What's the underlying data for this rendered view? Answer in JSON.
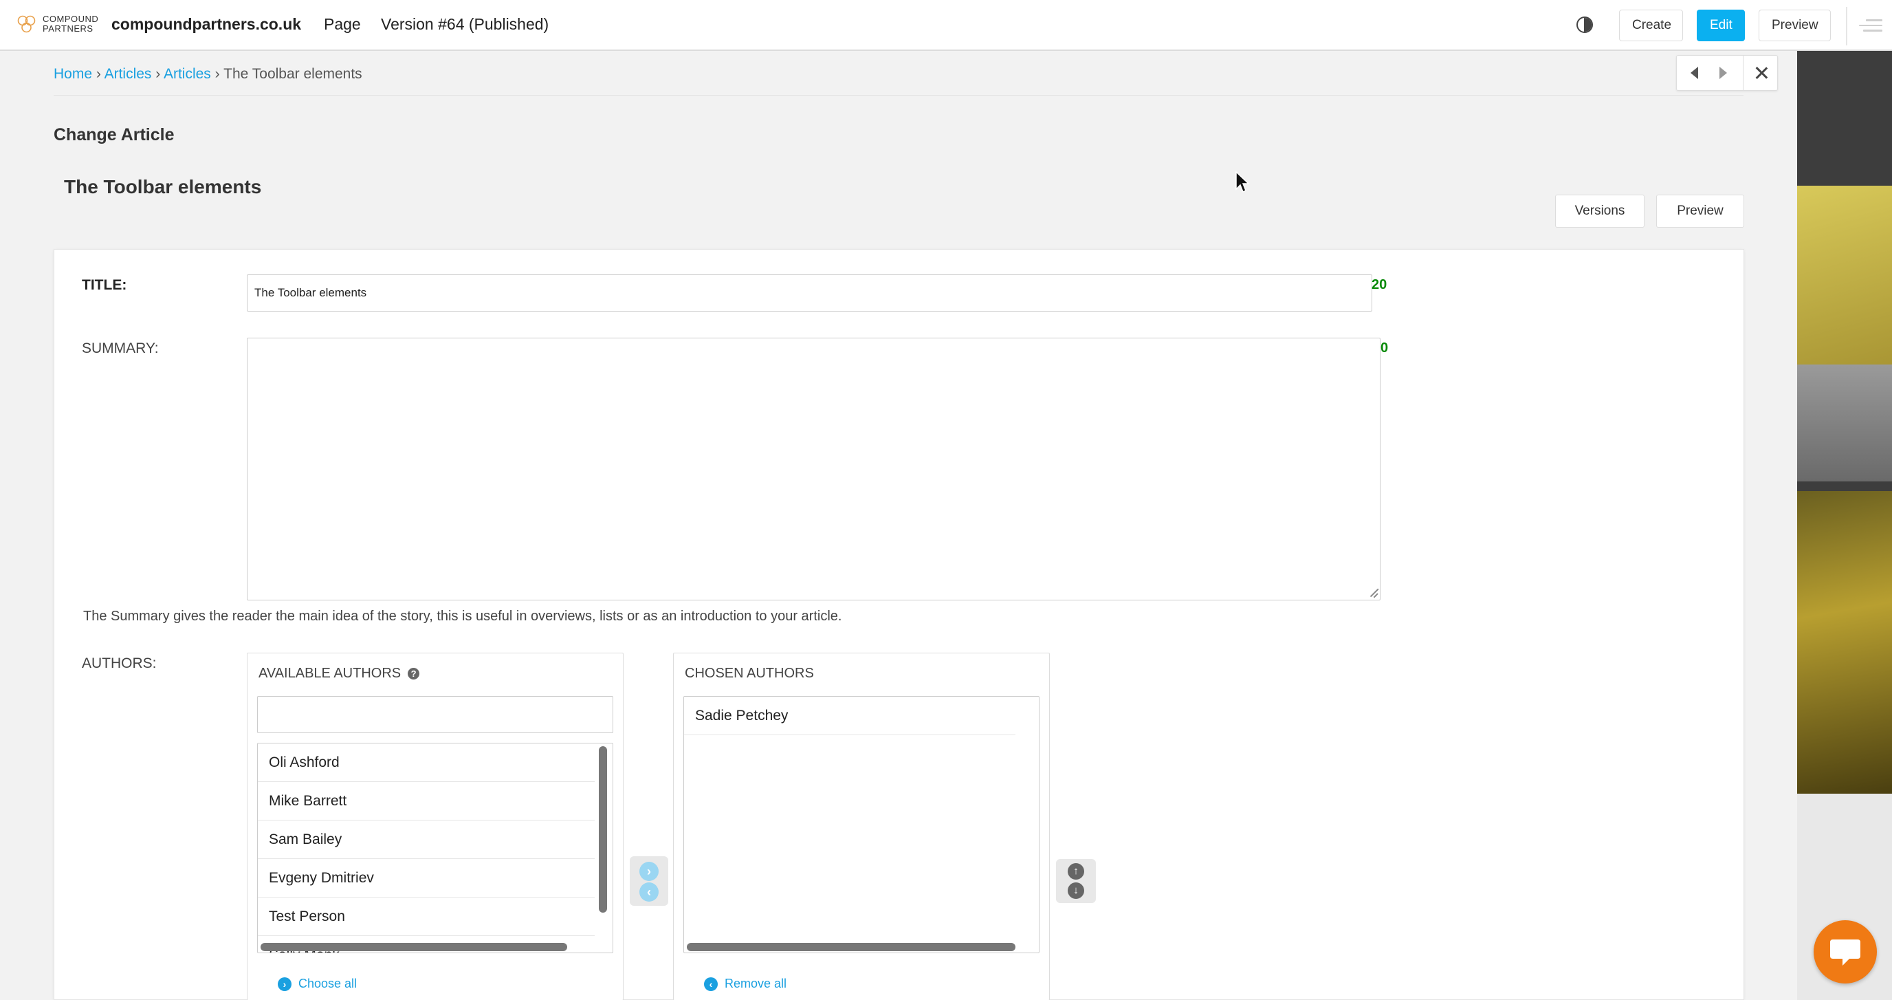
{
  "toolbar": {
    "logo_text_line1": "COMPOUND",
    "logo_text_line2": "PARTNERS",
    "site": "compoundpartners.co.uk",
    "page_label": "Page",
    "version": "Version #64 (Published)",
    "create_label": "Create",
    "edit_label": "Edit",
    "preview_label": "Preview"
  },
  "breadcrumb": {
    "home": "Home",
    "articles_app": "Articles",
    "articles_model": "Articles",
    "current": "The Toolbar elements",
    "separator": "›"
  },
  "page": {
    "heading": "Change Article",
    "object_title": "The Toolbar elements",
    "versions_label": "Versions",
    "preview_label": "Preview"
  },
  "form": {
    "title_label": "TITLE:",
    "title_value": "The Toolbar elements",
    "title_counter": "20",
    "summary_label": "SUMMARY:",
    "summary_value": "",
    "summary_counter": "0",
    "summary_help": "The Summary gives the reader the main idea of the story, this is useful in overviews, lists or as an introduction to your article.",
    "authors_label": "AUTHORS:"
  },
  "authors": {
    "available_heading": "AVAILABLE AUTHORS",
    "available_filter": "",
    "available": [
      "Oli Ashford",
      "Mike Barrett",
      "Sam Bailey",
      "Evgeny Dmitriev",
      "Test Person",
      "Sally Monk"
    ],
    "choose_all": "Choose all",
    "chosen_heading": "CHOSEN AUTHORS",
    "chosen": [
      "Sadie Petchey"
    ],
    "remove_all": "Remove all"
  },
  "colors": {
    "accent": "#0bb0f0",
    "link": "#1aa0e0",
    "counter": "#0a8a0a",
    "chat": "#f07a14"
  }
}
